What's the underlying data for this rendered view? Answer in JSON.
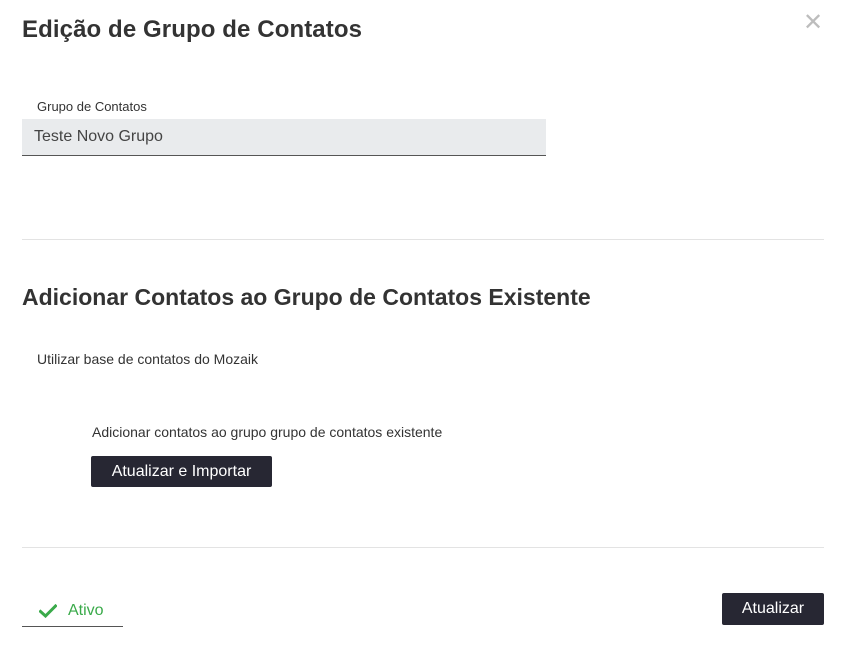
{
  "dialog": {
    "title": "Edição de Grupo de Contatos",
    "close_icon": "close-icon"
  },
  "group_field": {
    "label": "Grupo de Contatos",
    "value": "Teste Novo Grupo"
  },
  "add_section": {
    "title": "Adicionar Contatos ao Grupo de Contatos Existente",
    "base_label": "Utilizar base de contatos do Mozaik",
    "description": "Adicionar contatos ao grupo grupo de contatos existente",
    "import_button": "Atualizar e Importar"
  },
  "footer": {
    "status_label": "Ativo",
    "status_icon": "check-icon",
    "update_button": "Atualizar"
  },
  "colors": {
    "button_bg": "#272733",
    "active_green": "#3aaa4a",
    "input_bg": "#e9ebed",
    "close_gray": "#bdbdbd"
  }
}
